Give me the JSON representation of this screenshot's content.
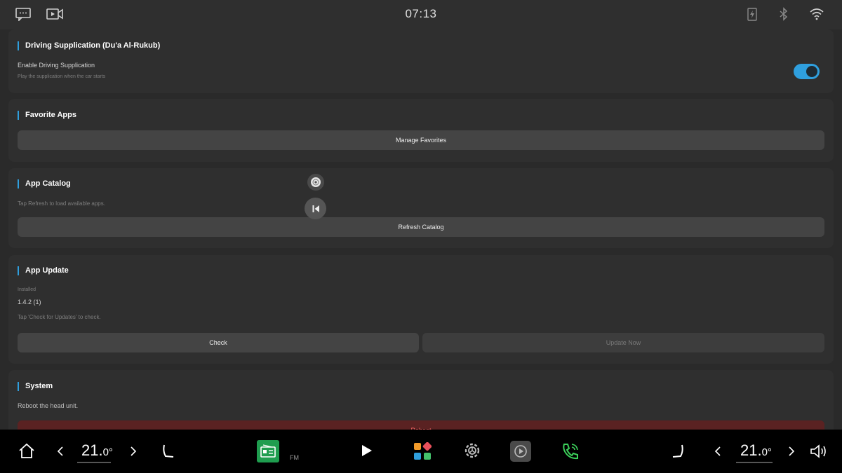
{
  "status_bar": {
    "clock": "07:13",
    "left_icons": [
      "message-icon",
      "video-icon"
    ],
    "right_icons": [
      "charging-icon",
      "bluetooth-icon",
      "wifi-icon"
    ]
  },
  "sections": {
    "driving": {
      "title": "Driving Supplication (Du'a Al-Rukub)",
      "toggle_label": "Enable Driving Supplication",
      "toggle_desc": "Play the supplication when the car starts",
      "toggle_on": true
    },
    "favorites": {
      "title": "Favorite Apps",
      "button": "Manage Favorites"
    },
    "catalog": {
      "title": "App Catalog",
      "hint": "Tap Refresh to load available apps.",
      "button": "Refresh Catalog"
    },
    "update": {
      "title": "App Update",
      "installed_label": "Installed",
      "installed_version": "1.4.2 (1)",
      "hint": "Tap 'Check for Updates' to check.",
      "check_button": "Check",
      "update_button": "Update Now"
    },
    "system": {
      "title": "System",
      "hint": "Reboot the head unit.",
      "reboot_button": "Reboot"
    }
  },
  "dock": {
    "left_temp": "21.",
    "left_temp_decimal": "0°",
    "right_temp": "21.",
    "right_temp_decimal": "0°",
    "radio_label": "FM"
  },
  "colors": {
    "accent": "#2f9fde",
    "background": "#2a2a2a",
    "card": "#2f2f2f",
    "dock": "#000000",
    "phone_green": "#3ccf5a"
  }
}
